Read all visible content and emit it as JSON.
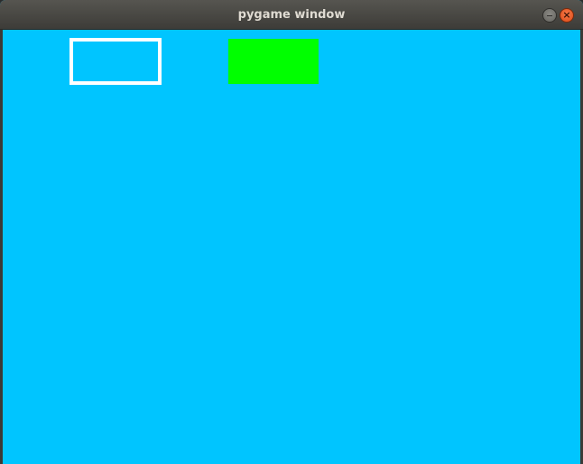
{
  "window": {
    "title": "pygame window",
    "controls": {
      "minimize_icon": "minimize-icon",
      "close_icon": "close-icon",
      "close_glyph": "×"
    }
  },
  "colors": {
    "background": "#00c5ff",
    "outline_rect": "#ffffff",
    "filled_rect": "#00ff00",
    "close_button": "#e95420"
  }
}
